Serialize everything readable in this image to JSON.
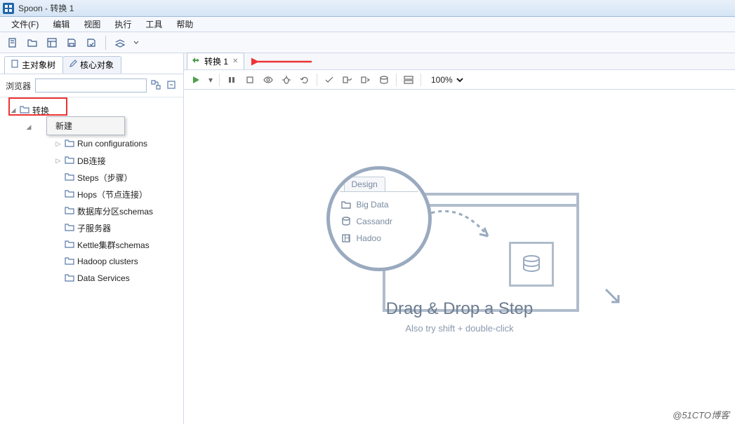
{
  "window": {
    "title": "Spoon - 转换 1"
  },
  "menu": [
    "文件(F)",
    "编辑",
    "视图",
    "执行",
    "工具",
    "帮助"
  ],
  "side": {
    "tabs": [
      {
        "label": "主对象树",
        "icon": "page-icon"
      },
      {
        "label": "核心对象",
        "icon": "pencil-icon"
      }
    ],
    "browser_label": "浏览器",
    "tree_root": "转换",
    "context_menu": [
      "新建"
    ],
    "nodes": [
      {
        "indent": 3,
        "label": "Run configurations",
        "expander": true
      },
      {
        "indent": 3,
        "label": "DB连接",
        "expander": true
      },
      {
        "indent": 3,
        "label": "Steps（步骤）",
        "expander": false
      },
      {
        "indent": 3,
        "label": "Hops（节点连接）",
        "expander": false
      },
      {
        "indent": 3,
        "label": "数据库分区schemas",
        "expander": false
      },
      {
        "indent": 3,
        "label": "子服务器",
        "expander": false
      },
      {
        "indent": 3,
        "label": "Kettle集群schemas",
        "expander": false
      },
      {
        "indent": 3,
        "label": "Hadoop clusters",
        "expander": false
      },
      {
        "indent": 3,
        "label": "Data Services",
        "expander": false
      }
    ]
  },
  "editor": {
    "tab_label": "转换 1",
    "zoom": "100%",
    "hint": {
      "design_tab": "Design",
      "rows": [
        "Big Data",
        "Cassandr",
        "Hadoo"
      ],
      "title": "Drag & Drop a Step",
      "subtitle": "Also try shift + double-click"
    }
  },
  "watermark": "@51CTO博客"
}
